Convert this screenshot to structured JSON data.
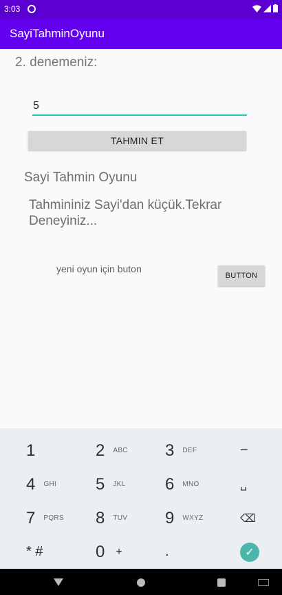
{
  "status": {
    "time": "3:03"
  },
  "app": {
    "title": "SayiTahminOyunu"
  },
  "main": {
    "attempt_label": "2. denemeniz:",
    "guess_value": "5",
    "guess_button": "TAHMIN ET",
    "game_title": "Sayi Tahmin Oyunu",
    "result_message": "Tahmininiz Sayi'dan küçük.Tekrar Deneyiniz...",
    "new_game_label": "yeni oyun için buton",
    "new_game_button": "BUTTON"
  },
  "keyboard": {
    "rows": [
      [
        {
          "d": "1",
          "l": ""
        },
        {
          "d": "2",
          "l": "ABC"
        },
        {
          "d": "3",
          "l": "DEF"
        },
        {
          "d": "−",
          "l": ""
        }
      ],
      [
        {
          "d": "4",
          "l": "GHI"
        },
        {
          "d": "5",
          "l": "JKL"
        },
        {
          "d": "6",
          "l": "MNO"
        },
        {
          "d": "␣",
          "l": ""
        }
      ],
      [
        {
          "d": "7",
          "l": "PQRS"
        },
        {
          "d": "8",
          "l": "TUV"
        },
        {
          "d": "9",
          "l": "WXYZ"
        },
        {
          "d": "⌫",
          "l": ""
        }
      ],
      [
        {
          "d": "* #",
          "l": ""
        },
        {
          "d": "0",
          "l": "+"
        },
        {
          "d": ".",
          "l": ""
        },
        {
          "d": "✓",
          "l": ""
        }
      ]
    ]
  },
  "colors": {
    "status_bar": "#5c00d2",
    "app_bar": "#6200ee",
    "input_underline": "#26c6b9",
    "done_key": "#4db6ac"
  }
}
